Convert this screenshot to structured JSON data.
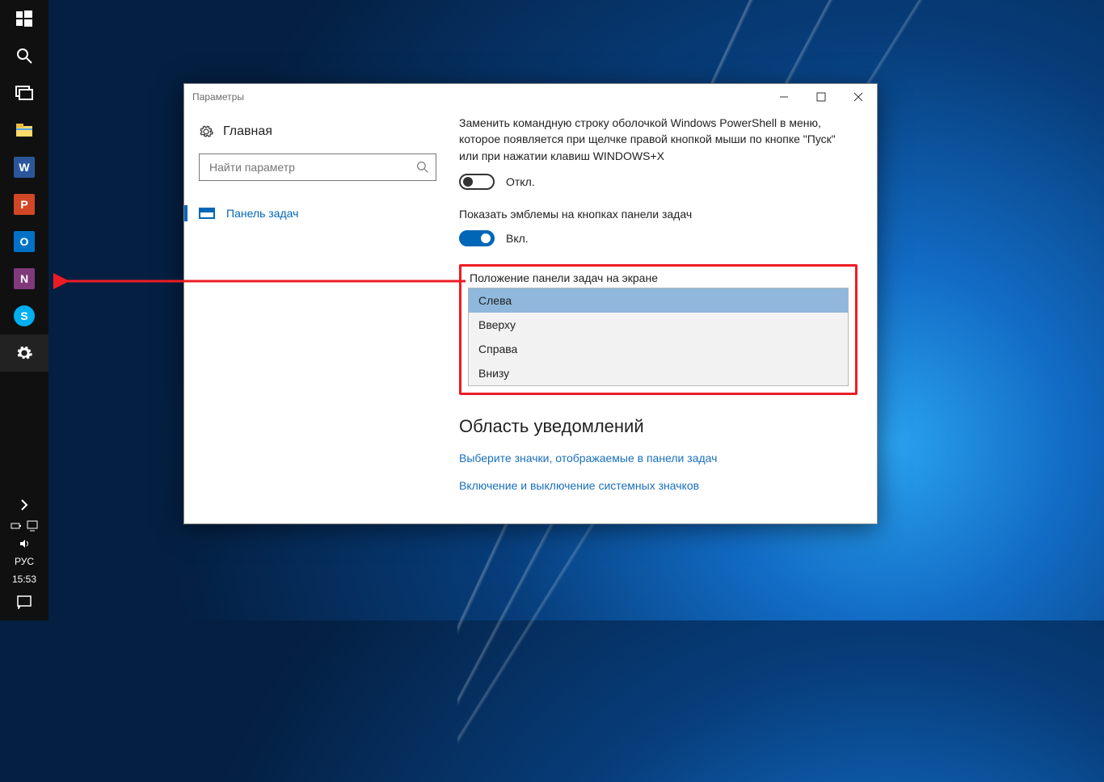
{
  "taskbar": {
    "items": [
      {
        "name": "start-button",
        "icon": "windows"
      },
      {
        "name": "search-button",
        "icon": "search"
      },
      {
        "name": "task-view-button",
        "icon": "taskview"
      },
      {
        "name": "file-explorer",
        "icon": "explorer"
      },
      {
        "name": "word-app",
        "label": "W",
        "color": "#2b579a"
      },
      {
        "name": "powerpoint-app",
        "label": "P",
        "color": "#d24726"
      },
      {
        "name": "outlook-app",
        "label": "O",
        "color": "#0072c6"
      },
      {
        "name": "onenote-app",
        "label": "N",
        "color": "#80397b"
      },
      {
        "name": "skype-app",
        "label": "S",
        "color": "#00aff0"
      },
      {
        "name": "settings-app",
        "icon": "gear",
        "active": true
      }
    ],
    "lang": "РУС",
    "time": "15:53"
  },
  "window": {
    "title": "Параметры"
  },
  "left": {
    "home": "Главная",
    "search_placeholder": "Найти параметр",
    "nav_item": "Панель задач"
  },
  "right": {
    "powershell_desc": "Заменить командную строку оболочкой Windows PowerShell в меню, которое появляется при щелчке правой кнопкой мыши по кнопке \"Пуск\" или при нажатии клавиш WINDOWS+X",
    "off_label": "Откл.",
    "show_badges_label": "Показать эмблемы на кнопках панели задач",
    "on_label": "Вкл.",
    "position_label": "Положение панели задач на экране",
    "options": [
      "Слева",
      "Вверху",
      "Справа",
      "Внизу"
    ],
    "notifications_header": "Область уведомлений",
    "link_select_icons": "Выберите значки, отображаемые в панели задач",
    "link_system_icons": "Включение и выключение системных значков"
  }
}
